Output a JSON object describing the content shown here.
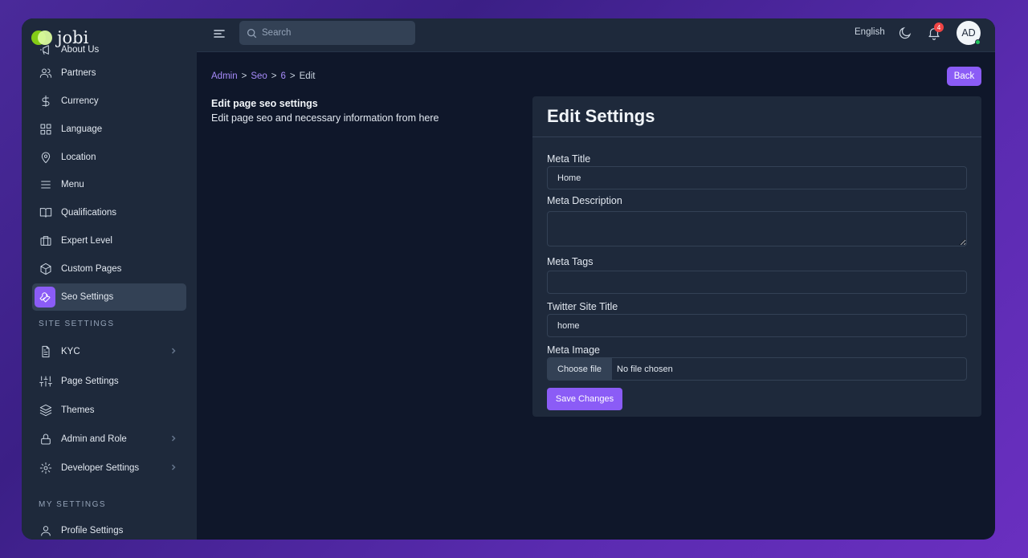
{
  "app": {
    "name": "jobi"
  },
  "topbar": {
    "search_placeholder": "Search",
    "language": "English",
    "notification_count": "4",
    "avatar_initials": "AD"
  },
  "sidebar": {
    "items": [
      {
        "label": "About Us",
        "icon": "megaphone-icon"
      },
      {
        "label": "Partners",
        "icon": "users-icon"
      },
      {
        "label": "Currency",
        "icon": "dollar-icon"
      },
      {
        "label": "Language",
        "icon": "grid-icon"
      },
      {
        "label": "Location",
        "icon": "map-pin-icon"
      },
      {
        "label": "Menu",
        "icon": "menu-icon"
      },
      {
        "label": "Qualifications",
        "icon": "book-icon"
      },
      {
        "label": "Expert Level",
        "icon": "briefcase-icon"
      },
      {
        "label": "Custom Pages",
        "icon": "box-icon"
      },
      {
        "label": "Seo Settings",
        "icon": "wrench-icon",
        "active": true
      }
    ],
    "site_settings_label": "SITE SETTINGS",
    "site_items": [
      {
        "label": "KYC",
        "icon": "file-icon",
        "has_children": true
      },
      {
        "label": "Page Settings",
        "icon": "sliders-icon"
      },
      {
        "label": "Themes",
        "icon": "layers-icon"
      },
      {
        "label": "Admin and Role",
        "icon": "lock-icon",
        "has_children": true
      },
      {
        "label": "Developer Settings",
        "icon": "gear-icon",
        "has_children": true
      }
    ],
    "my_settings_label": "MY SETTINGS",
    "my_items": [
      {
        "label": "Profile Settings",
        "icon": "user-icon"
      }
    ]
  },
  "breadcrumb": {
    "items": [
      "Admin",
      "Seo",
      "6",
      "Edit"
    ],
    "separator": ">"
  },
  "back_label": "Back",
  "intro": {
    "title": "Edit page seo settings",
    "subtitle": "Edit page seo and necessary information from here"
  },
  "card": {
    "title": "Edit Settings",
    "meta_title_label": "Meta Title",
    "meta_title_value": "Home",
    "meta_description_label": "Meta Description",
    "meta_description_value": "",
    "meta_tags_label": "Meta Tags",
    "meta_tags_value": "",
    "twitter_site_title_label": "Twitter Site Title",
    "twitter_site_title_value": "home",
    "meta_image_label": "Meta Image",
    "choose_file_label": "Choose file",
    "no_file_label": "No file chosen",
    "save_label": "Save Changes"
  },
  "colors": {
    "accent": "#8b5cf6",
    "background": "#0f172a",
    "panel": "#1e293b"
  }
}
